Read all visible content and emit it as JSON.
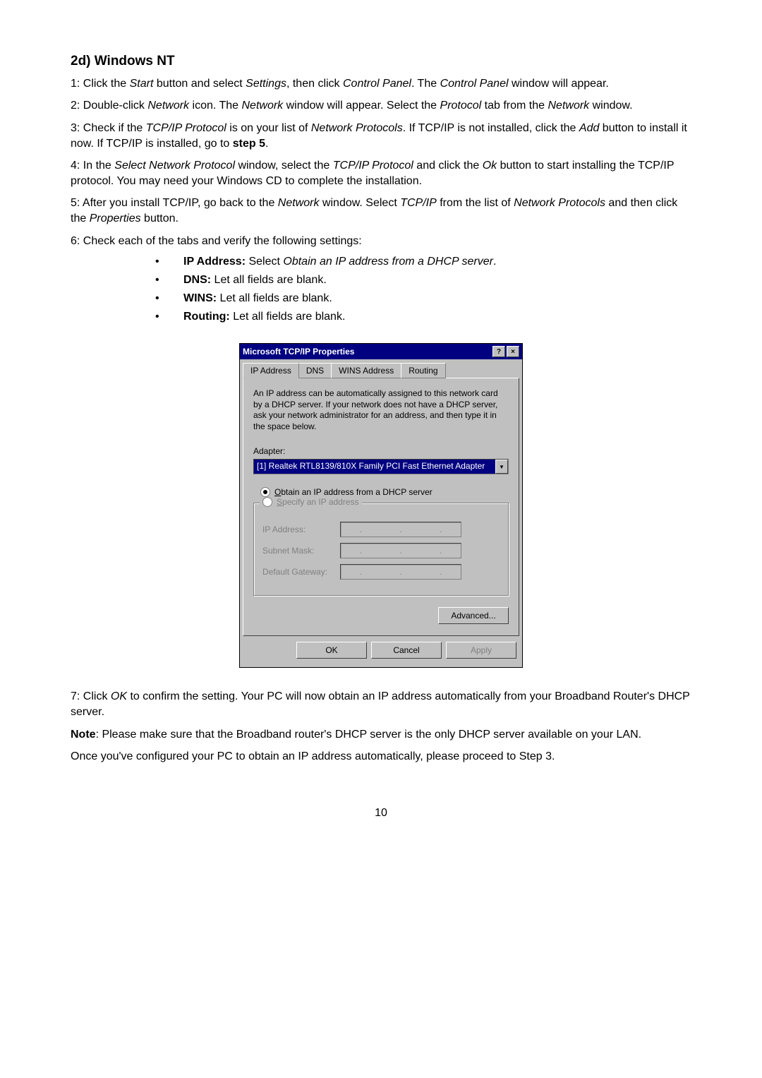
{
  "heading": "2d) Windows NT",
  "steps": {
    "s1a": "1: Click the ",
    "s1_start": "Start",
    "s1b": " button and select ",
    "s1_settings": "Settings",
    "s1c": ", then click ",
    "s1_cp": "Control Panel",
    "s1d": ". The ",
    "s1_cp2": "Control Panel",
    "s1e": " window will appear.",
    "s2a": "2: Double-click ",
    "s2_net": "Network",
    "s2b": " icon. The ",
    "s2_net2": "Network",
    "s2c": " window will appear. Select the ",
    "s2_proto": "Protocol",
    "s2d": " tab from the ",
    "s2_net3": "Network",
    "s2e": " window.",
    "s3a": "3: Check if the ",
    "s3_tcp": "TCP/IP Protocol",
    "s3b": " is on your list of ",
    "s3_np": "Network Protocols",
    "s3c": ". If TCP/IP is not installed, click the ",
    "s3_add": "Add",
    "s3d": " button to install it now. If TCP/IP is installed, go to ",
    "s3_step5": "step 5",
    "s3e": ".",
    "s4a": "4: In the ",
    "s4_snp": "Select Network Protocol",
    "s4b": " window, select the ",
    "s4_tcp": "TCP/IP Protocol",
    "s4c": " and click the ",
    "s4_ok": "Ok",
    "s4d": " button to start installing the TCP/IP protocol. You may need your Windows CD to complete the installation.",
    "s5a": "5: After you install TCP/IP, go back to the ",
    "s5_net": "Network",
    "s5b": " window. Select ",
    "s5_tcp": "TCP/IP",
    "s5c": " from the list of ",
    "s5_np": "Network Protocols",
    "s5d": " and then click the ",
    "s5_prop": "Properties",
    "s5e": " button.",
    "s6": "6: Check each of the tabs and verify the following settings:"
  },
  "bullets": {
    "b1_label": "IP Address:",
    "b1a": " Select ",
    "b1_txt": "Obtain an IP address from a DHCP server",
    "b1b": ".",
    "b2_label": "DNS:",
    "b2_txt": " Let all fields are blank.",
    "b3_label": "WINS:",
    "b3_txt": " Let all fields are blank.",
    "b4_label": "Routing:",
    "b4_txt": " Let all fields are blank."
  },
  "dialog": {
    "title": "Microsoft TCP/IP Properties",
    "help_btn": "?",
    "close_btn": "×",
    "tabs": {
      "ip": "IP Address",
      "dns": "DNS",
      "wins": "WINS Address",
      "routing": "Routing"
    },
    "desc": "An IP address can be automatically assigned to this network card by a DHCP server. If your network does not have a DHCP server, ask your network administrator for an address, and then type it in the space below.",
    "adapter_label": "Adapter:",
    "adapter_value": "[1] Realtek RTL8139/810X Family PCI Fast Ethernet Adapter",
    "radio_obtain": "Obtain an IP address from a DHCP server",
    "radio_specify": "Specify an IP address",
    "ip_label": "IP Address:",
    "subnet_label": "Subnet Mask:",
    "gateway_label": "Default Gateway:",
    "dots": ". . .",
    "advanced": "Advanced...",
    "ok": "OK",
    "cancel": "Cancel",
    "apply": "Apply"
  },
  "after": {
    "s7a": "7: Click ",
    "s7_ok": "OK",
    "s7b": " to confirm the setting. Your PC will now obtain an IP address automatically from your Broadband Router's DHCP server.",
    "note_label": "Note",
    "note_txt": ": Please make sure that the Broadband router's DHCP server is the only DHCP server available on your LAN.",
    "final": "Once you've configured your PC to obtain an IP address automatically, please proceed to Step 3."
  },
  "pagenum": "10"
}
